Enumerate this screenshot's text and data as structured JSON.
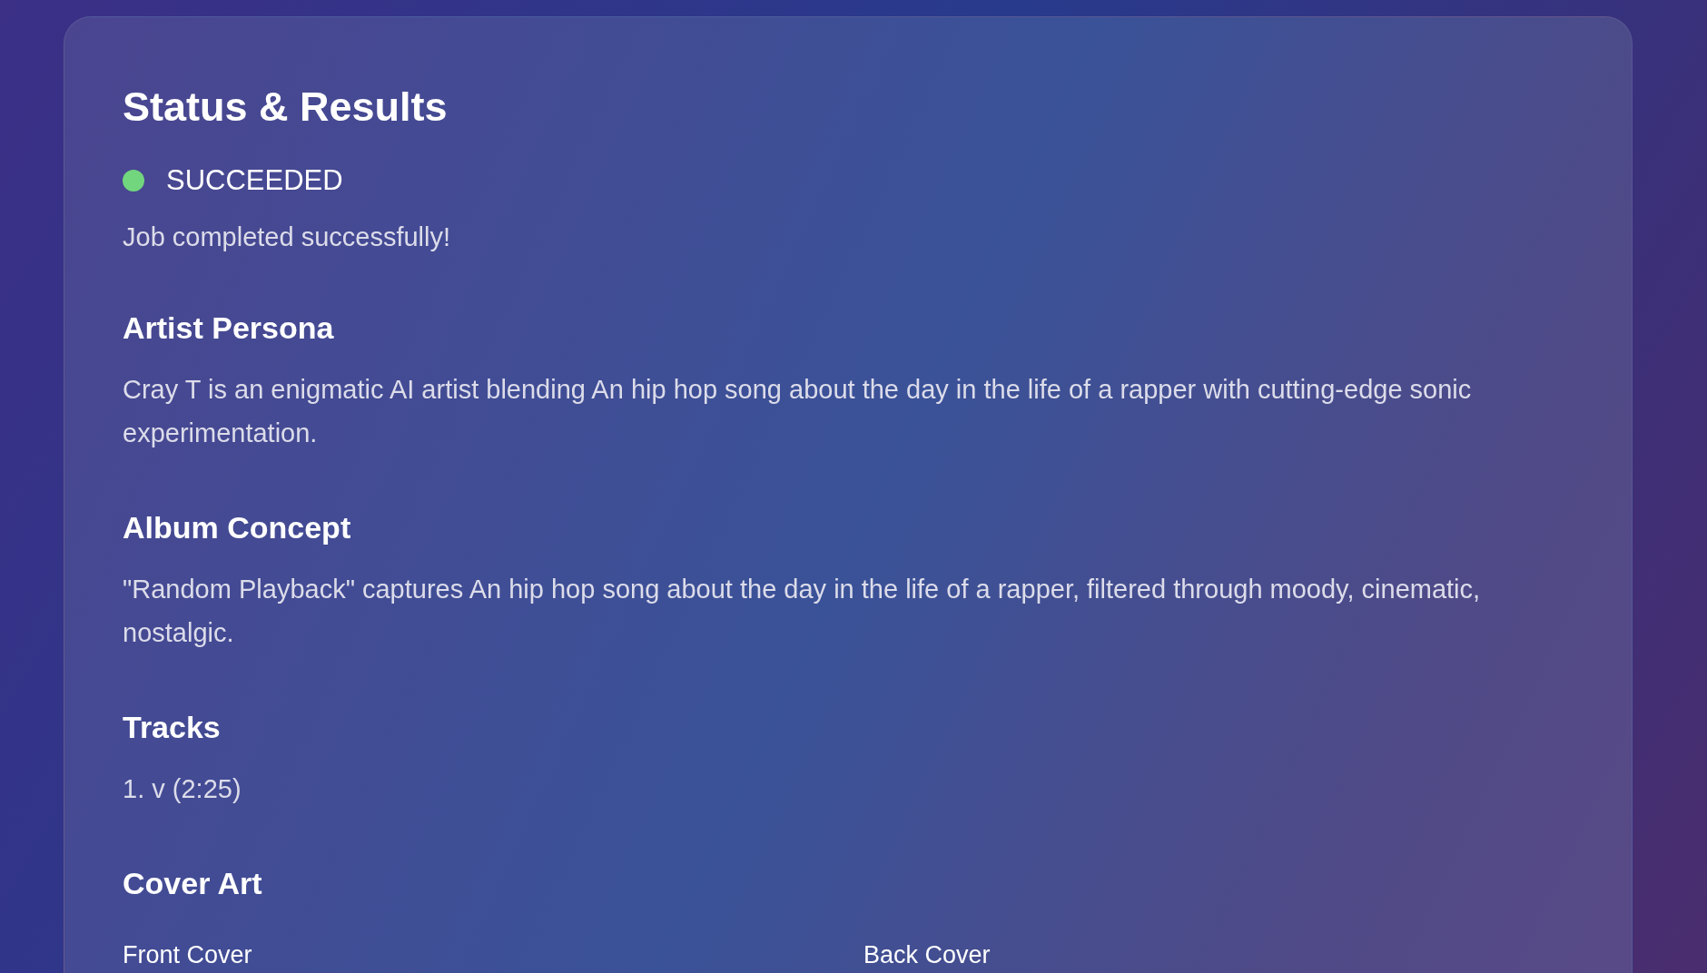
{
  "panel": {
    "title": "Status & Results"
  },
  "status": {
    "label": "SUCCEEDED",
    "kind": "success",
    "message": "Job completed successfully!"
  },
  "sections": [
    {
      "heading": "Artist Persona",
      "text": "Cray T is an enigmatic AI artist blending An hip hop song about the day in the life of a rapper with cutting-edge sonic experimentation."
    },
    {
      "heading": "Album Concept",
      "text": "\"Random Playback\" captures An hip hop song about the day in the life of a rapper, filtered through moody, cinematic, nostalgic."
    }
  ],
  "tracks": {
    "heading": "Tracks",
    "items": [
      "1. v (2:25)"
    ]
  },
  "cover_art": {
    "heading": "Cover Art",
    "covers": [
      {
        "label": "Front Cover"
      },
      {
        "label": "Back Cover"
      }
    ]
  }
}
